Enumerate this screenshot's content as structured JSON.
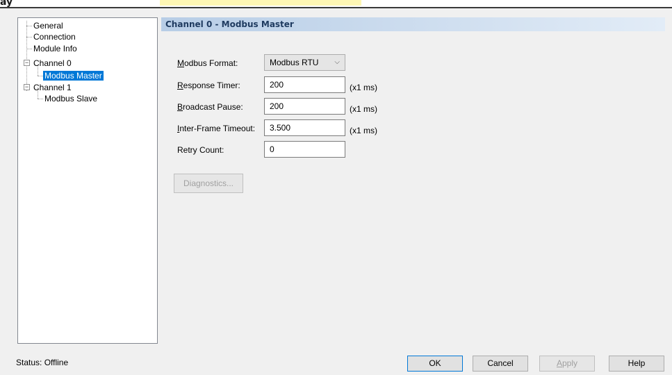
{
  "top_strip": {
    "corner_text": "ay"
  },
  "tree": {
    "items": [
      {
        "label": "General"
      },
      {
        "label": "Connection"
      },
      {
        "label": "Module Info"
      },
      {
        "label": "Channel 0",
        "expander": "−"
      },
      {
        "label": "Modbus Master"
      },
      {
        "label": "Channel 1",
        "expander": "−"
      },
      {
        "label": "Modbus Slave"
      }
    ]
  },
  "panel": {
    "title": "Channel 0 - Modbus Master",
    "fields": {
      "modbus_format": {
        "label_u": "M",
        "label_rest": "odbus Format:",
        "value": "Modbus RTU",
        "chevron": "⌵"
      },
      "response_timer": {
        "label_u": "R",
        "label_rest": "esponse Timer:",
        "value": "200",
        "unit": "(x1 ms)"
      },
      "broadcast_pause": {
        "label_u": "B",
        "label_rest": "roadcast Pause:",
        "value": "200",
        "unit": "(x1 ms)"
      },
      "inter_frame_timeout": {
        "label_u": "I",
        "label_rest": "nter-Frame Timeout:",
        "value": "3.500",
        "unit": "(x1 ms)"
      },
      "retry_count": {
        "label": "Retry Count:",
        "value": "0"
      }
    },
    "diagnostics_label": "Diagnostics..."
  },
  "status": {
    "text": "Status:  Offline"
  },
  "buttons": {
    "ok": "OK",
    "cancel": "Cancel",
    "apply_u": "A",
    "apply_rest": "pply",
    "help": "Help"
  }
}
